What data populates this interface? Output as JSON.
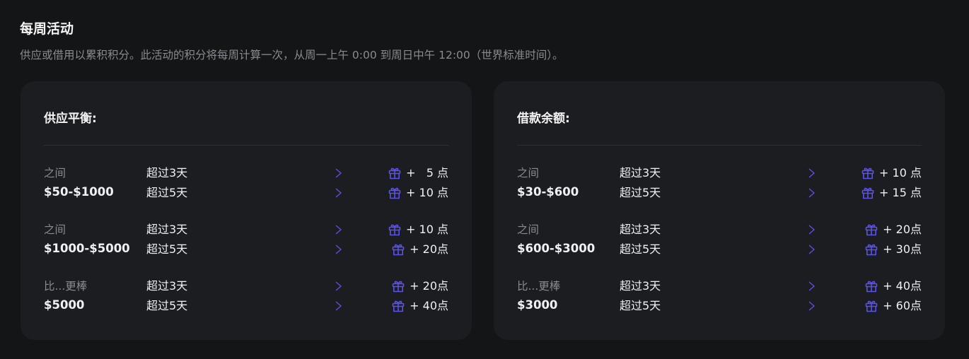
{
  "header": {
    "title": "每周活动",
    "description": "供应或借用以累积积分。此活动的积分将每周计算一次，从周一上午 0:00 到周日中午 12:00（世界标准时间）。"
  },
  "colors": {
    "accent": "#5b52e8",
    "background": "#141517",
    "card": "#1c1d21"
  },
  "cards": [
    {
      "title": "供应平衡:",
      "tiers": [
        {
          "label": "之间",
          "range": "$50-$1000",
          "rows": [
            {
              "duration": "超过3天",
              "points": "+   5 点"
            },
            {
              "duration": "超过5天",
              "points": "+ 10 点"
            }
          ]
        },
        {
          "label": "之间",
          "range": "$1000-$5000",
          "rows": [
            {
              "duration": "超过3天",
              "points": "+ 10 点"
            },
            {
              "duration": "超过5天",
              "points": "+ 20点"
            }
          ]
        },
        {
          "label": "比...更棒",
          "range": "$5000",
          "rows": [
            {
              "duration": "超过3天",
              "points": "+ 20点"
            },
            {
              "duration": "超过5天",
              "points": "+ 40点"
            }
          ]
        }
      ]
    },
    {
      "title": "借款余额:",
      "tiers": [
        {
          "label": "之间",
          "range": "$30-$600",
          "rows": [
            {
              "duration": "超过3天",
              "points": "+ 10 点"
            },
            {
              "duration": "超过5天",
              "points": "+ 15 点"
            }
          ]
        },
        {
          "label": "之间",
          "range": "$600-$3000",
          "rows": [
            {
              "duration": "超过3天",
              "points": "+ 20点"
            },
            {
              "duration": "超过5天",
              "points": "+ 30点"
            }
          ]
        },
        {
          "label": "比...更棒",
          "range": "$3000",
          "rows": [
            {
              "duration": "超过3天",
              "points": "+ 40点"
            },
            {
              "duration": "超过5天",
              "points": "+ 60点"
            }
          ]
        }
      ]
    }
  ],
  "icons": {
    "reward": "gift-icon",
    "arrow": "arrow-right-icon"
  }
}
